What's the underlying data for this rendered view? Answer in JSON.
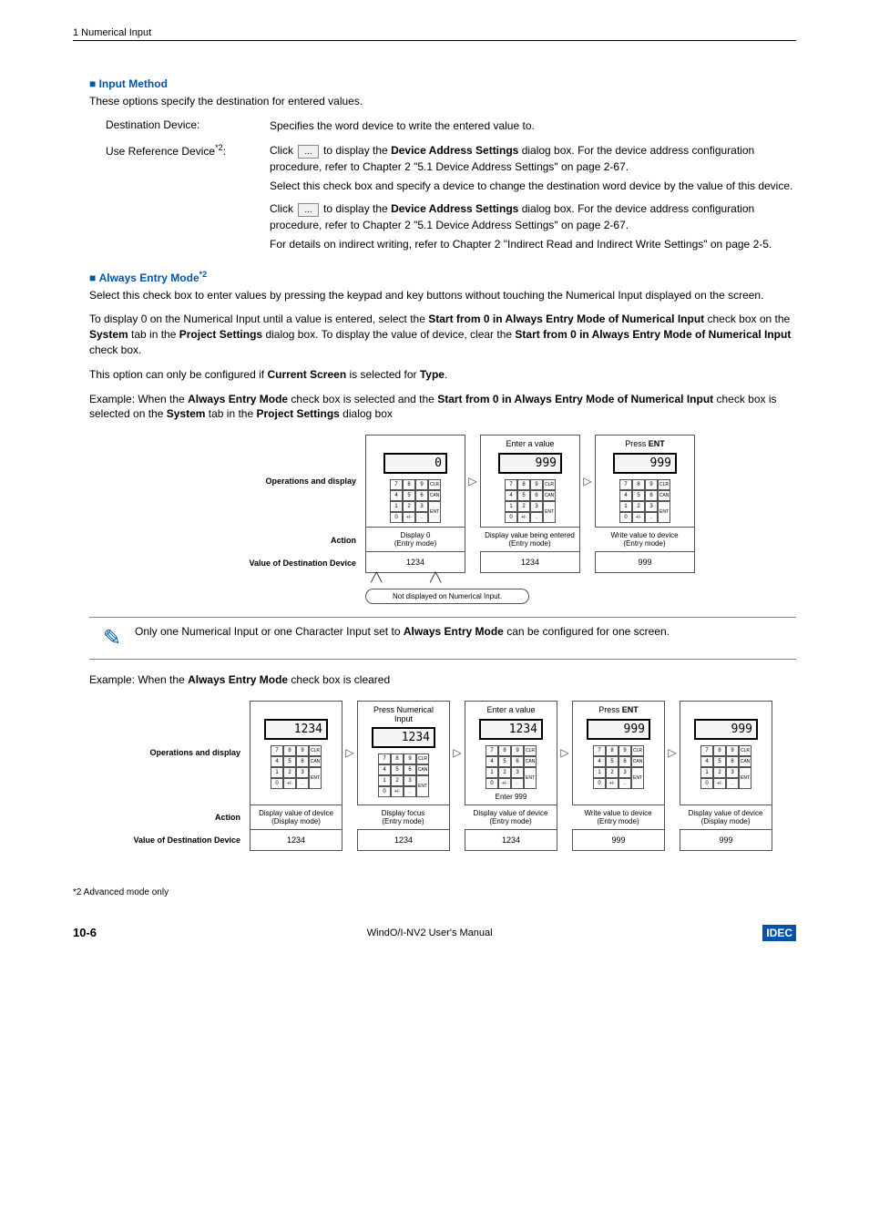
{
  "header": {
    "chapter": "1 Numerical Input"
  },
  "inputMethod": {
    "title": "Input Method",
    "intro": "These options specify the destination for entered values.",
    "dest": {
      "label": "Destination Device:",
      "text": "Specifies the word device to write the entered value to."
    },
    "ref": {
      "label": "Use Reference Device",
      "sup": "*2",
      "colon": ":",
      "p1a": "Click ",
      "p1b": " to display the ",
      "p1bold": "Device Address Settings",
      "p1c": " dialog box. For the device address configuration procedure, refer to Chapter 2 \"5.1 Device Address Settings\" on page 2-67.",
      "p2": "Select this check box and specify a device to change the destination word device by the value of this device.",
      "p3a": "Click ",
      "p3b": " to display the ",
      "p3bold": "Device Address Settings",
      "p3c": " dialog box. For the device address configuration procedure, refer to Chapter 2 \"5.1 Device Address Settings\" on page 2-67.",
      "p4": "For details on indirect writing, refer to Chapter 2 \"Indirect Read and Indirect Write Settings\" on page 2-5.",
      "dots": "..."
    }
  },
  "always": {
    "title": "Always Entry Mode",
    "sup": "*2",
    "p1": "Select this check box to enter values by pressing the keypad and key buttons without touching the Numerical Input displayed on the screen.",
    "p2a": "To display 0 on the Numerical Input until a value is entered, select the ",
    "p2b1": "Start from 0 in Always Entry Mode of Numerical Input",
    "p2c": " check box on the ",
    "p2b2": "System",
    "p2d": " tab in the ",
    "p2b3": "Project Settings",
    "p2e": " dialog box. To display the value of device, clear the ",
    "p2b4": "Start from 0 in Always Entry Mode of Numerical Input",
    "p2f": " check box.",
    "p3a": "This option can only be configured if ",
    "p3b1": "Current Screen",
    "p3b": " is selected for ",
    "p3b2": "Type",
    "p3c": ".",
    "ex1a": "Example: When the ",
    "ex1b1": "Always Entry Mode",
    "ex1b": " check box is selected and the ",
    "ex1b2": "Start from 0 in Always Entry Mode of Numerical Input",
    "ex1c": " check box is selected on the ",
    "ex1b3": "System",
    "ex1d": " tab in the ",
    "ex1b4": "Project Settings",
    "ex1e": " dialog box",
    "diagram1": {
      "rowlabels": {
        "ops": "Operations and display",
        "action": "Action",
        "val": "Value of Destination Device"
      },
      "cols": [
        {
          "header": "",
          "disp": "0",
          "action1": "Display 0",
          "action2": "(Entry mode)",
          "val": "1234"
        },
        {
          "header": "Enter a value",
          "disp": "999",
          "action1": "Display value being entered",
          "action2": "(Entry mode)",
          "val": "1234"
        },
        {
          "header_a": "Press ",
          "header_b": "ENT",
          "disp": "999",
          "action1": "Write value to device",
          "action2": "(Entry mode)",
          "val": "999"
        }
      ],
      "bubble": "Not displayed on Numerical Input."
    },
    "note": "Only one Numerical Input or one Character Input set to ",
    "noteBold": "Always Entry Mode",
    "note2": " can be configured for one screen.",
    "ex2a": "Example: When the ",
    "ex2b": "Always Entry Mode",
    "ex2c": " check box is cleared",
    "diagram2": {
      "rowlabels": {
        "ops": "Operations and display",
        "action": "Action",
        "val": "Value of Destination Device"
      },
      "cols": [
        {
          "header": "",
          "disp": "1234",
          "action1": "Display value of device",
          "action2": "(Display mode)",
          "val": "1234",
          "extra": ""
        },
        {
          "header": "Press Numerical Input",
          "disp": "1234",
          "action1": "Display focus",
          "action2": "(Entry mode)",
          "val": "1234",
          "extra": ""
        },
        {
          "header": "Enter a value",
          "disp": "1234",
          "action1": "Display value of device",
          "action2": "(Entry mode)",
          "val": "1234",
          "extra": "Enter 999"
        },
        {
          "header_a": "Press ",
          "header_b": "ENT",
          "disp": "999",
          "action1": "Write value to device",
          "action2": "(Entry mode)",
          "val": "999",
          "extra": ""
        },
        {
          "header": "",
          "disp": "999",
          "action1": "Display value of device",
          "action2": "(Display mode)",
          "val": "999",
          "extra": ""
        }
      ]
    }
  },
  "keypad": {
    "keys": [
      "7",
      "8",
      "9",
      "CLR",
      "4",
      "5",
      "6",
      "CAN",
      "1",
      "2",
      "3",
      "0",
      "+/-",
      ".",
      "ENT"
    ]
  },
  "footnote": "*2  Advanced mode only",
  "footer": {
    "pagenum": "10-6",
    "manual": "WindO/I-NV2 User's Manual",
    "logo": "IDEC"
  }
}
